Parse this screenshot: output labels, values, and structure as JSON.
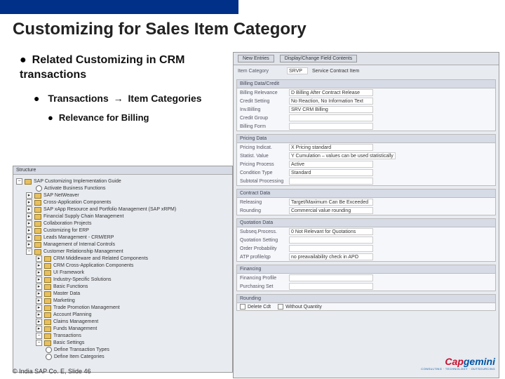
{
  "title": "Customizing for Sales Item Category",
  "bullets": {
    "b1": "Related Customizing in CRM transactions",
    "b2_a": "Transactions",
    "b2_b": "Item Categories",
    "b3": "Relevance for Billing"
  },
  "sap_right": {
    "toolbar": {
      "btn1": "New Entries",
      "btn2": "Display/Change Field Contents"
    },
    "header_rows": [
      {
        "lbl": "Item Category",
        "val": "SRVP",
        "desc": "Service Contract Item"
      }
    ],
    "panels": [
      {
        "title": "Billing Data/Credit",
        "rows": [
          {
            "lbl": "Billing Relevance",
            "val": "D Billing After Contract Release"
          },
          {
            "lbl": "Credit Setting",
            "val": "No Reaction, No Information Text"
          },
          {
            "lbl": "Inv.Billing",
            "val": "SRV CRM Billing"
          },
          {
            "lbl": "Credit Group",
            "val": ""
          },
          {
            "lbl": "Billing Form",
            "val": ""
          }
        ]
      },
      {
        "title": "Pricing Data",
        "rows": [
          {
            "lbl": "Pricing Indicat.",
            "val": "X Pricing standard"
          },
          {
            "lbl": "Statist. Value",
            "val": "Y Cumulation – values can be used statistically"
          },
          {
            "lbl": "Pricing Process",
            "val": "Active"
          },
          {
            "lbl": "Condition Type",
            "val": "Standard"
          },
          {
            "lbl": "Subtotal Processing",
            "val": ""
          }
        ]
      },
      {
        "title": "Contract Data",
        "rows": [
          {
            "lbl": "Releasing",
            "val": "Target/Maximum Can Be Exceeded"
          },
          {
            "lbl": "Rounding",
            "val": "Commercial value rounding"
          }
        ]
      },
      {
        "title": "Quotation Data",
        "rows": [
          {
            "lbl": "Subseq.Process.",
            "val": "0 Not Relevant for Quotations"
          },
          {
            "lbl": "Quotation Setting",
            "val": ""
          },
          {
            "lbl": "Order Probability",
            "val": ""
          },
          {
            "lbl": "ATP profile/qp",
            "val": "no preavailability check in APO"
          }
        ]
      },
      {
        "title": "Financing",
        "rows": [
          {
            "lbl": "Financing Profile",
            "val": ""
          },
          {
            "lbl": "Purchasing Set",
            "val": ""
          }
        ]
      },
      {
        "title": "Rounding",
        "checks": [
          "Delete Cdt",
          "Without Quantity"
        ]
      }
    ]
  },
  "sap_left": {
    "hdr": "Structure",
    "nodes": [
      {
        "lvl": 1,
        "exp": "−",
        "ico": "folder",
        "txt": "SAP Customizing Implementation Guide"
      },
      {
        "lvl": 2,
        "exp": "",
        "ico": "clock",
        "txt": "Activate Business Functions"
      },
      {
        "lvl": 2,
        "exp": "▸",
        "ico": "folder",
        "txt": "SAP NetWeaver"
      },
      {
        "lvl": 2,
        "exp": "▸",
        "ico": "folder",
        "txt": "Cross-Application Components"
      },
      {
        "lvl": 2,
        "exp": "▸",
        "ico": "folder",
        "txt": "SAP xApp Resource and Portfolio Management (SAP xRPM)"
      },
      {
        "lvl": 2,
        "exp": "▸",
        "ico": "folder",
        "txt": "Financial Supply Chain Management"
      },
      {
        "lvl": 2,
        "exp": "▸",
        "ico": "folder",
        "txt": "Collaboration Projects"
      },
      {
        "lvl": 2,
        "exp": "▸",
        "ico": "folder",
        "txt": "Customizing for ERP"
      },
      {
        "lvl": 2,
        "exp": "▸",
        "ico": "folder",
        "txt": "Leads Management - CRM/ERP"
      },
      {
        "lvl": 2,
        "exp": "▸",
        "ico": "folder",
        "txt": "Management of Internal Controls"
      },
      {
        "lvl": 2,
        "exp": "−",
        "ico": "folder",
        "txt": "Customer Relationship Management"
      },
      {
        "lvl": 3,
        "exp": "▸",
        "ico": "folder",
        "txt": "CRM Middleware and Related Components"
      },
      {
        "lvl": 3,
        "exp": "▸",
        "ico": "folder",
        "txt": "CRM Cross-Application Components"
      },
      {
        "lvl": 3,
        "exp": "▸",
        "ico": "folder",
        "txt": "UI Framework"
      },
      {
        "lvl": 3,
        "exp": "▸",
        "ico": "folder",
        "txt": "Industry-Specific Solutions"
      },
      {
        "lvl": 3,
        "exp": "▸",
        "ico": "folder",
        "txt": "Basic Functions"
      },
      {
        "lvl": 3,
        "exp": "▸",
        "ico": "folder",
        "txt": "Master Data"
      },
      {
        "lvl": 3,
        "exp": "▸",
        "ico": "folder",
        "txt": "Marketing"
      },
      {
        "lvl": 3,
        "exp": "▸",
        "ico": "folder",
        "txt": "Trade Promotion Management"
      },
      {
        "lvl": 3,
        "exp": "▸",
        "ico": "folder",
        "txt": "Account Planning"
      },
      {
        "lvl": 3,
        "exp": "▸",
        "ico": "folder",
        "txt": "Claims Management"
      },
      {
        "lvl": 3,
        "exp": "▸",
        "ico": "folder",
        "txt": "Funds Management"
      },
      {
        "lvl": 3,
        "exp": "−",
        "ico": "folder",
        "txt": "Transactions"
      },
      {
        "lvl": 3,
        "exp": "−",
        "ico": "folder",
        "txt": "Basic Settings"
      },
      {
        "lvl": 3,
        "exp": "",
        "ico": "clock",
        "txt": "Define Transaction Types"
      },
      {
        "lvl": 3,
        "exp": "",
        "ico": "clock",
        "txt": "Define Item Categories"
      }
    ]
  },
  "footer": "© India SAP Co. E, Slide 46",
  "logo": {
    "main_a": "Cap",
    "main_b": "gemini",
    "sub": "CONSULTING · TECHNOLOGY · OUTSOURCING"
  }
}
